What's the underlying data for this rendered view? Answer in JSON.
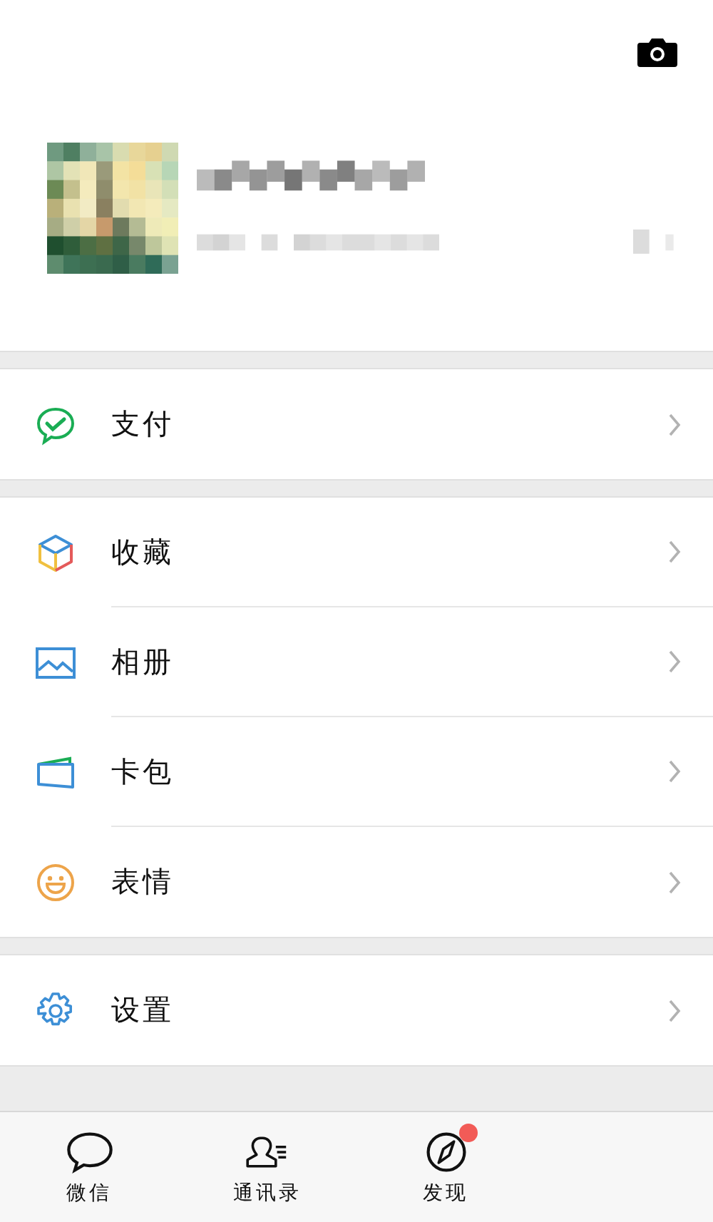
{
  "groups": [
    {
      "items": [
        {
          "kind": "pay",
          "label": "支付"
        }
      ]
    },
    {
      "items": [
        {
          "kind": "favorites",
          "label": "收藏"
        },
        {
          "kind": "album",
          "label": "相册"
        },
        {
          "kind": "cards",
          "label": "卡包"
        },
        {
          "kind": "stickers",
          "label": "表情"
        }
      ]
    },
    {
      "items": [
        {
          "kind": "settings",
          "label": "设置"
        }
      ]
    }
  ],
  "tabs": [
    {
      "kind": "chats",
      "label": "微信",
      "selected": false,
      "badge": false
    },
    {
      "kind": "contacts",
      "label": "通讯录",
      "selected": false,
      "badge": false
    },
    {
      "kind": "discover",
      "label": "发现",
      "selected": false,
      "badge": true
    }
  ]
}
